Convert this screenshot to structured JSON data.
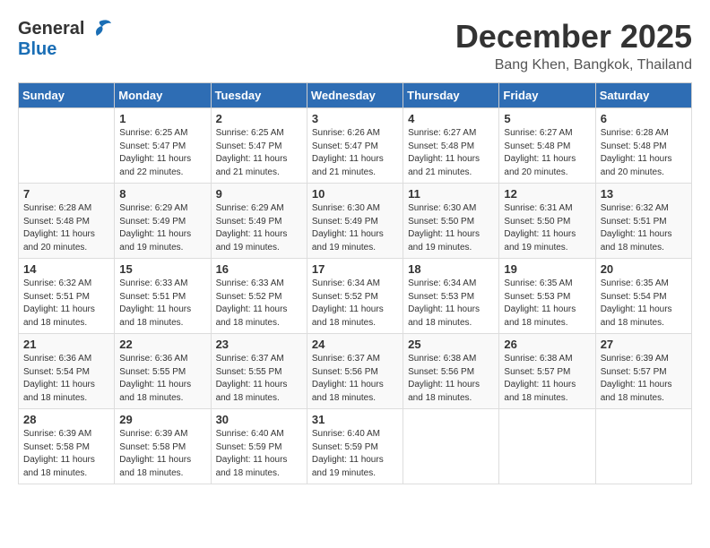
{
  "header": {
    "logo_general": "General",
    "logo_blue": "Blue",
    "month_title": "December 2025",
    "location": "Bang Khen, Bangkok, Thailand"
  },
  "weekdays": [
    "Sunday",
    "Monday",
    "Tuesday",
    "Wednesday",
    "Thursday",
    "Friday",
    "Saturday"
  ],
  "weeks": [
    [
      {
        "day": "",
        "sunrise": "",
        "sunset": "",
        "daylight": ""
      },
      {
        "day": "1",
        "sunrise": "Sunrise: 6:25 AM",
        "sunset": "Sunset: 5:47 PM",
        "daylight": "Daylight: 11 hours and 22 minutes."
      },
      {
        "day": "2",
        "sunrise": "Sunrise: 6:25 AM",
        "sunset": "Sunset: 5:47 PM",
        "daylight": "Daylight: 11 hours and 21 minutes."
      },
      {
        "day": "3",
        "sunrise": "Sunrise: 6:26 AM",
        "sunset": "Sunset: 5:47 PM",
        "daylight": "Daylight: 11 hours and 21 minutes."
      },
      {
        "day": "4",
        "sunrise": "Sunrise: 6:27 AM",
        "sunset": "Sunset: 5:48 PM",
        "daylight": "Daylight: 11 hours and 21 minutes."
      },
      {
        "day": "5",
        "sunrise": "Sunrise: 6:27 AM",
        "sunset": "Sunset: 5:48 PM",
        "daylight": "Daylight: 11 hours and 20 minutes."
      },
      {
        "day": "6",
        "sunrise": "Sunrise: 6:28 AM",
        "sunset": "Sunset: 5:48 PM",
        "daylight": "Daylight: 11 hours and 20 minutes."
      }
    ],
    [
      {
        "day": "7",
        "sunrise": "Sunrise: 6:28 AM",
        "sunset": "Sunset: 5:48 PM",
        "daylight": "Daylight: 11 hours and 20 minutes."
      },
      {
        "day": "8",
        "sunrise": "Sunrise: 6:29 AM",
        "sunset": "Sunset: 5:49 PM",
        "daylight": "Daylight: 11 hours and 19 minutes."
      },
      {
        "day": "9",
        "sunrise": "Sunrise: 6:29 AM",
        "sunset": "Sunset: 5:49 PM",
        "daylight": "Daylight: 11 hours and 19 minutes."
      },
      {
        "day": "10",
        "sunrise": "Sunrise: 6:30 AM",
        "sunset": "Sunset: 5:49 PM",
        "daylight": "Daylight: 11 hours and 19 minutes."
      },
      {
        "day": "11",
        "sunrise": "Sunrise: 6:30 AM",
        "sunset": "Sunset: 5:50 PM",
        "daylight": "Daylight: 11 hours and 19 minutes."
      },
      {
        "day": "12",
        "sunrise": "Sunrise: 6:31 AM",
        "sunset": "Sunset: 5:50 PM",
        "daylight": "Daylight: 11 hours and 19 minutes."
      },
      {
        "day": "13",
        "sunrise": "Sunrise: 6:32 AM",
        "sunset": "Sunset: 5:51 PM",
        "daylight": "Daylight: 11 hours and 18 minutes."
      }
    ],
    [
      {
        "day": "14",
        "sunrise": "Sunrise: 6:32 AM",
        "sunset": "Sunset: 5:51 PM",
        "daylight": "Daylight: 11 hours and 18 minutes."
      },
      {
        "day": "15",
        "sunrise": "Sunrise: 6:33 AM",
        "sunset": "Sunset: 5:51 PM",
        "daylight": "Daylight: 11 hours and 18 minutes."
      },
      {
        "day": "16",
        "sunrise": "Sunrise: 6:33 AM",
        "sunset": "Sunset: 5:52 PM",
        "daylight": "Daylight: 11 hours and 18 minutes."
      },
      {
        "day": "17",
        "sunrise": "Sunrise: 6:34 AM",
        "sunset": "Sunset: 5:52 PM",
        "daylight": "Daylight: 11 hours and 18 minutes."
      },
      {
        "day": "18",
        "sunrise": "Sunrise: 6:34 AM",
        "sunset": "Sunset: 5:53 PM",
        "daylight": "Daylight: 11 hours and 18 minutes."
      },
      {
        "day": "19",
        "sunrise": "Sunrise: 6:35 AM",
        "sunset": "Sunset: 5:53 PM",
        "daylight": "Daylight: 11 hours and 18 minutes."
      },
      {
        "day": "20",
        "sunrise": "Sunrise: 6:35 AM",
        "sunset": "Sunset: 5:54 PM",
        "daylight": "Daylight: 11 hours and 18 minutes."
      }
    ],
    [
      {
        "day": "21",
        "sunrise": "Sunrise: 6:36 AM",
        "sunset": "Sunset: 5:54 PM",
        "daylight": "Daylight: 11 hours and 18 minutes."
      },
      {
        "day": "22",
        "sunrise": "Sunrise: 6:36 AM",
        "sunset": "Sunset: 5:55 PM",
        "daylight": "Daylight: 11 hours and 18 minutes."
      },
      {
        "day": "23",
        "sunrise": "Sunrise: 6:37 AM",
        "sunset": "Sunset: 5:55 PM",
        "daylight": "Daylight: 11 hours and 18 minutes."
      },
      {
        "day": "24",
        "sunrise": "Sunrise: 6:37 AM",
        "sunset": "Sunset: 5:56 PM",
        "daylight": "Daylight: 11 hours and 18 minutes."
      },
      {
        "day": "25",
        "sunrise": "Sunrise: 6:38 AM",
        "sunset": "Sunset: 5:56 PM",
        "daylight": "Daylight: 11 hours and 18 minutes."
      },
      {
        "day": "26",
        "sunrise": "Sunrise: 6:38 AM",
        "sunset": "Sunset: 5:57 PM",
        "daylight": "Daylight: 11 hours and 18 minutes."
      },
      {
        "day": "27",
        "sunrise": "Sunrise: 6:39 AM",
        "sunset": "Sunset: 5:57 PM",
        "daylight": "Daylight: 11 hours and 18 minutes."
      }
    ],
    [
      {
        "day": "28",
        "sunrise": "Sunrise: 6:39 AM",
        "sunset": "Sunset: 5:58 PM",
        "daylight": "Daylight: 11 hours and 18 minutes."
      },
      {
        "day": "29",
        "sunrise": "Sunrise: 6:39 AM",
        "sunset": "Sunset: 5:58 PM",
        "daylight": "Daylight: 11 hours and 18 minutes."
      },
      {
        "day": "30",
        "sunrise": "Sunrise: 6:40 AM",
        "sunset": "Sunset: 5:59 PM",
        "daylight": "Daylight: 11 hours and 18 minutes."
      },
      {
        "day": "31",
        "sunrise": "Sunrise: 6:40 AM",
        "sunset": "Sunset: 5:59 PM",
        "daylight": "Daylight: 11 hours and 19 minutes."
      },
      {
        "day": "",
        "sunrise": "",
        "sunset": "",
        "daylight": ""
      },
      {
        "day": "",
        "sunrise": "",
        "sunset": "",
        "daylight": ""
      },
      {
        "day": "",
        "sunrise": "",
        "sunset": "",
        "daylight": ""
      }
    ]
  ]
}
